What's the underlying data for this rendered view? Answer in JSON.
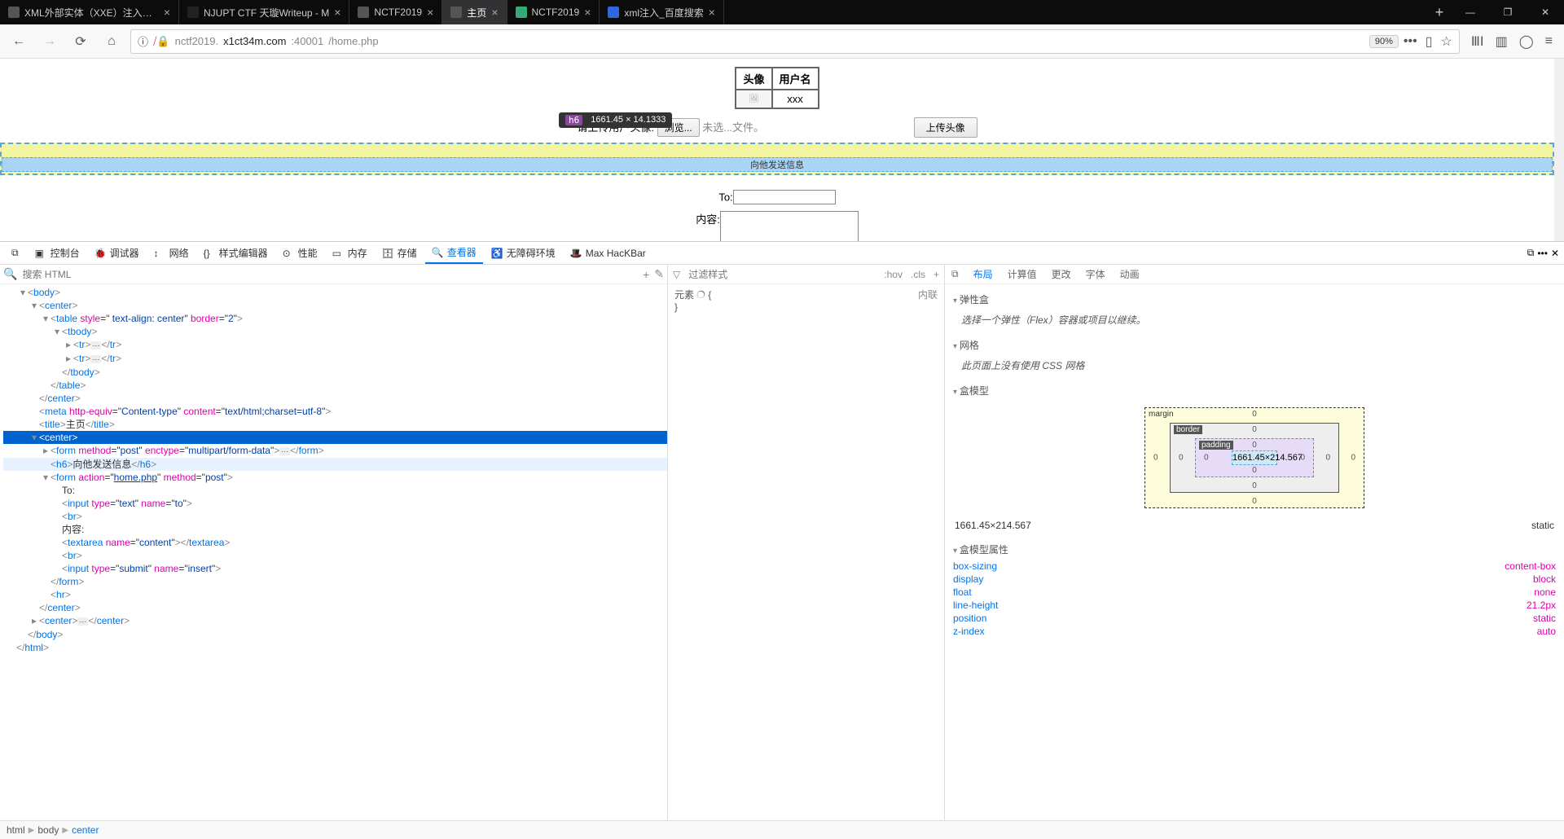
{
  "titlebar": {
    "tabs": [
      {
        "title": "XML外部实体（XXE）注入详解",
        "favColor": "#555"
      },
      {
        "title": "NJUPT CTF 天璇Writeup - M",
        "favColor": "#222"
      },
      {
        "title": "NCTF2019",
        "favColor": "#555"
      },
      {
        "title": "主页",
        "favColor": "#555",
        "active": true
      },
      {
        "title": "NCTF2019",
        "favColor": "#3a7"
      },
      {
        "title": "xml注入_百度搜索",
        "favColor": "#36d"
      }
    ]
  },
  "nav": {
    "url_prefix": "nctf2019.",
    "url_host": "x1ct34m.com",
    "url_port": ":40001",
    "url_path": "/home.php",
    "zoom": "90%"
  },
  "tooltip": {
    "tag": "h6",
    "dim": "1661.45 × 14.1333"
  },
  "page": {
    "th1": "头像",
    "th2": "用户名",
    "td_user": "xxx",
    "upload_label": "请上传用户头像:",
    "browse": "浏览...",
    "nofile": "未选...文件。",
    "upload_btn": "上传头像",
    "h6": "向他发送信息",
    "to_label": "To:",
    "content_label": "内容:"
  },
  "devtools": {
    "toolbar": [
      "控制台",
      "调试器",
      "网络",
      "样式编辑器",
      "性能",
      "内存",
      "存储",
      "查看器",
      "无障碍环境",
      "Max HacKBar"
    ],
    "active": "查看器",
    "search_placeholder": "搜索 HTML",
    "midhead": {
      "filter": "过滤样式",
      "hov": ":hov",
      "cls": ".cls",
      "plus": "+"
    },
    "mid": {
      "l1": "元素",
      "brace": "{",
      "inline": "内联",
      "close": "}"
    },
    "righttabs": [
      "布局",
      "计算值",
      "更改",
      "字体",
      "动画"
    ],
    "rightactive": "布局",
    "sections": {
      "flex_title": "弹性盒",
      "flex_msg": "选择一个弹性（Flex）容器或项目以继续。",
      "grid_title": "网格",
      "grid_msg": "此页面上没有使用 CSS 网格",
      "box_title": "盒模型",
      "margin": "margin",
      "border": "border",
      "padding": "padding",
      "content_dim": "1661.45×214.567",
      "sizeline": "1661.45×214.567",
      "pos": "static",
      "boxprops_title": "盒模型属性",
      "props": [
        {
          "k": "box-sizing",
          "v": "content-box"
        },
        {
          "k": "display",
          "v": "block"
        },
        {
          "k": "float",
          "v": "none"
        },
        {
          "k": "line-height",
          "v": "21.2px"
        },
        {
          "k": "position",
          "v": "static"
        },
        {
          "k": "z-index",
          "v": "auto"
        }
      ]
    },
    "breadcrumb": [
      "html",
      "body",
      "center"
    ],
    "dom": [
      {
        "ind": 1,
        "tw": "▾",
        "html": "<span class=pl>&lt;</span><span class=tg>body</span><span class=pl>&gt;</span>"
      },
      {
        "ind": 2,
        "tw": "▾",
        "html": "<span class=pl>&lt;</span><span class=tg>center</span><span class=pl>&gt;</span>"
      },
      {
        "ind": 3,
        "tw": "▾",
        "html": "<span class=pl>&lt;</span><span class=tg>table</span> <span class=at>style</span>=\"<span class=av> text-align: center</span>\" <span class=at>border</span>=\"<span class=av>2</span>\"<span class=pl>&gt;</span>"
      },
      {
        "ind": 4,
        "tw": "▾",
        "html": "<span class=pl>&lt;</span><span class=tg>tbody</span><span class=pl>&gt;</span>"
      },
      {
        "ind": 5,
        "tw": "▸",
        "html": "<span class=pl>&lt;</span><span class=tg>tr</span><span class=pl>&gt;</span><span class=dots>⋯</span><span class=pl>&lt;/</span><span class=tg>tr</span><span class=pl>&gt;</span>"
      },
      {
        "ind": 5,
        "tw": "▸",
        "html": "<span class=pl>&lt;</span><span class=tg>tr</span><span class=pl>&gt;</span><span class=dots>⋯</span><span class=pl>&lt;/</span><span class=tg>tr</span><span class=pl>&gt;</span>"
      },
      {
        "ind": 4,
        "tw": " ",
        "html": "<span class=pl>&lt;/</span><span class=tg>tbody</span><span class=pl>&gt;</span>"
      },
      {
        "ind": 3,
        "tw": " ",
        "html": "<span class=pl>&lt;/</span><span class=tg>table</span><span class=pl>&gt;</span>"
      },
      {
        "ind": 2,
        "tw": " ",
        "html": "<span class=pl>&lt;/</span><span class=tg>center</span><span class=pl>&gt;</span>"
      },
      {
        "ind": 2,
        "tw": " ",
        "html": "<span class=pl>&lt;</span><span class=tg>meta</span> <span class=at>http-equiv</span>=\"<span class=av>Content-type</span>\" <span class=at>content</span>=\"<span class=av>text/html;charset=utf-8</span>\"<span class=pl>&gt;</span>"
      },
      {
        "ind": 2,
        "tw": " ",
        "html": "<span class=pl>&lt;</span><span class=tg>title</span><span class=pl>&gt;</span><span class=tx>主页</span><span class=pl>&lt;/</span><span class=tg>title</span><span class=pl>&gt;</span>"
      },
      {
        "ind": 2,
        "tw": "▾",
        "html": "<span class=pl>&lt;</span><span class=tg>center</span><span class=pl>&gt;</span>",
        "sel": true
      },
      {
        "ind": 3,
        "tw": "▸",
        "html": "<span class=pl>&lt;</span><span class=tg>form</span> <span class=at>method</span>=\"<span class=av>post</span>\" <span class=at>enctype</span>=\"<span class=av>multipart/form-data</span>\"<span class=pl>&gt;</span><span class=dots>⋯</span><span class=pl>&lt;/</span><span class=tg>form</span><span class=pl>&gt;</span>"
      },
      {
        "ind": 3,
        "tw": " ",
        "html": "<span class=pl>&lt;</span><span class=tg>h6</span><span class=pl>&gt;</span><span class=tx>向他发送信息</span><span class=pl>&lt;/</span><span class=tg>h6</span><span class=pl>&gt;</span>",
        "hov": true
      },
      {
        "ind": 3,
        "tw": "▾",
        "html": "<span class=pl>&lt;</span><span class=tg>form</span> <span class=at>action</span>=\"<span class=av style='text-decoration:underline'>home.php</span>\" <span class=at>method</span>=\"<span class=av>post</span>\"<span class=pl>&gt;</span>"
      },
      {
        "ind": 4,
        "tw": " ",
        "html": "<span class=tx>To:</span>"
      },
      {
        "ind": 4,
        "tw": " ",
        "html": "<span class=pl>&lt;</span><span class=tg>input</span> <span class=at>type</span>=\"<span class=av>text</span>\" <span class=at>name</span>=\"<span class=av>to</span>\"<span class=pl>&gt;</span>"
      },
      {
        "ind": 4,
        "tw": " ",
        "html": "<span class=pl>&lt;</span><span class=tg>br</span><span class=pl>&gt;</span>"
      },
      {
        "ind": 4,
        "tw": " ",
        "html": "<span class=tx>内容:</span>"
      },
      {
        "ind": 4,
        "tw": " ",
        "html": "<span class=pl>&lt;</span><span class=tg>textarea</span> <span class=at>name</span>=\"<span class=av>content</span>\"<span class=pl>&gt;&lt;/</span><span class=tg>textarea</span><span class=pl>&gt;</span>"
      },
      {
        "ind": 4,
        "tw": " ",
        "html": "<span class=pl>&lt;</span><span class=tg>br</span><span class=pl>&gt;</span>"
      },
      {
        "ind": 4,
        "tw": " ",
        "html": "<span class=pl>&lt;</span><span class=tg>input</span> <span class=at>type</span>=\"<span class=av>submit</span>\" <span class=at>name</span>=\"<span class=av>insert</span>\"<span class=pl>&gt;</span>"
      },
      {
        "ind": 3,
        "tw": " ",
        "html": "<span class=pl>&lt;/</span><span class=tg>form</span><span class=pl>&gt;</span>"
      },
      {
        "ind": 3,
        "tw": " ",
        "html": "<span class=pl>&lt;</span><span class=tg>hr</span><span class=pl>&gt;</span>"
      },
      {
        "ind": 2,
        "tw": " ",
        "html": "<span class=pl>&lt;/</span><span class=tg>center</span><span class=pl>&gt;</span>"
      },
      {
        "ind": 2,
        "tw": "▸",
        "html": "<span class=pl>&lt;</span><span class=tg>center</span><span class=pl>&gt;</span><span class=dots>⋯</span><span class=pl>&lt;/</span><span class=tg>center</span><span class=pl>&gt;</span>"
      },
      {
        "ind": 1,
        "tw": " ",
        "html": "<span class=pl>&lt;/</span><span class=tg>body</span><span class=pl>&gt;</span>"
      },
      {
        "ind": 0,
        "tw": " ",
        "html": "<span class=pl>&lt;/</span><span class=tg>html</span><span class=pl>&gt;</span>"
      }
    ]
  }
}
